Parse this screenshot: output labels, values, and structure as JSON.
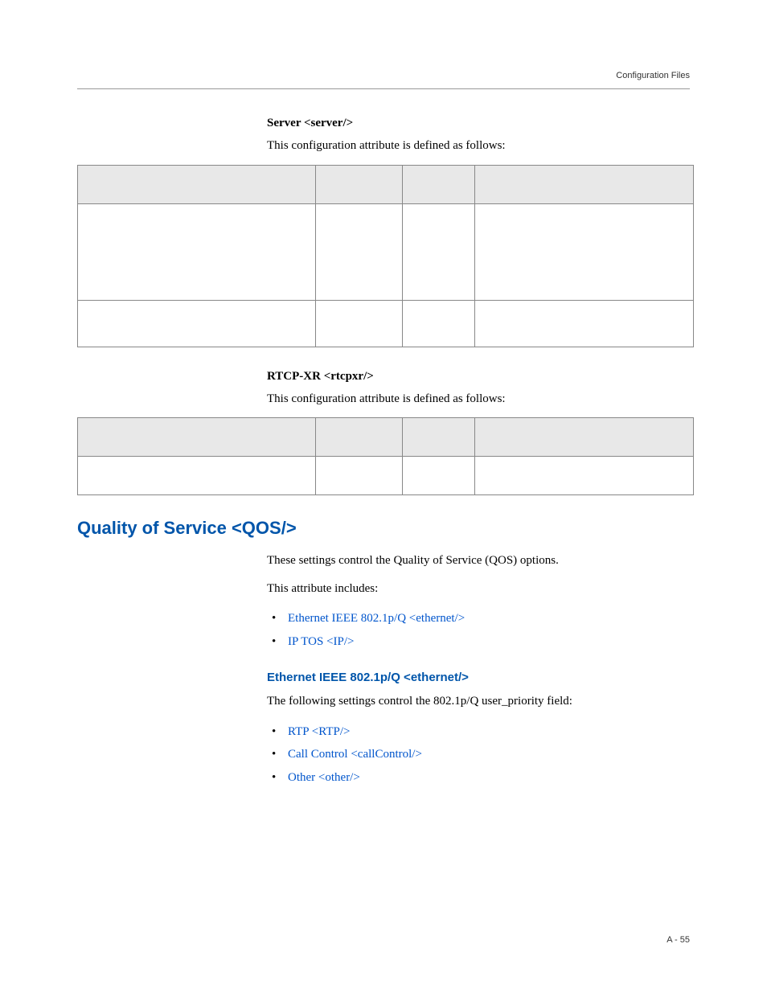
{
  "header": {
    "running_title": "Configuration Files"
  },
  "sections": {
    "server": {
      "title": "Server <server/>",
      "intro": "This configuration attribute is defined as follows:"
    },
    "rtcpxr": {
      "title": "RTCP-XR <rtcpxr/>",
      "intro": "This configuration attribute is defined as follows:"
    },
    "qos": {
      "title": "Quality of Service <QOS/>",
      "para1": "These settings control the Quality of Service (QOS) options.",
      "para2": "This attribute includes:",
      "bullets": [
        "Ethernet IEEE 802.1p/Q <ethernet/>",
        "IP TOS <IP/>"
      ]
    },
    "ethernet": {
      "title": "Ethernet IEEE 802.1p/Q <ethernet/>",
      "intro": "The following settings control the 802.1p/Q user_priority field:",
      "bullets": [
        "RTP <RTP/>",
        "Call Control <callControl/>",
        "Other <other/>"
      ]
    }
  },
  "footer": {
    "page_label": "A - 55"
  }
}
